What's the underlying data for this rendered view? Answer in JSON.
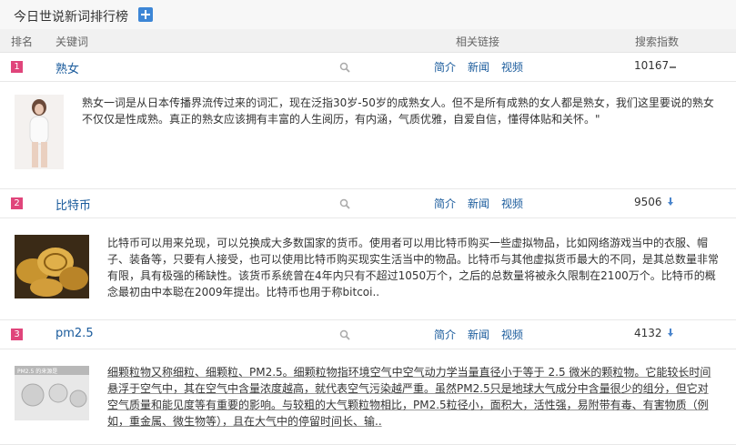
{
  "header": {
    "title": "今日世说新词排行榜",
    "columns": {
      "rank": "排名",
      "keyword": "关键词",
      "links": "相关链接",
      "index": "搜索指数"
    }
  },
  "entries": [
    {
      "rank": "1",
      "keyword": "熟女",
      "links": {
        "intro": "简介",
        "news": "新闻",
        "video": "视频"
      },
      "index": "10167",
      "trend": "flat",
      "description": "熟女一词是从日本传播界流传过来的词汇，现在泛指30岁-50岁的成熟女人。但不是所有成熟的女人都是熟女，我们这里要说的熟女不仅仅是性成熟。真正的熟女应该拥有丰富的人生阅历，有内涵，气质优雅，自爱自信，懂得体贴和关怀。\"",
      "thumb_icon": "photo-woman"
    },
    {
      "rank": "2",
      "keyword": "比特币",
      "links": {
        "intro": "简介",
        "news": "新闻",
        "video": "视频"
      },
      "index": "9506",
      "trend": "down",
      "description": "比特币可以用来兑现，可以兑换成大多数国家的货币。使用者可以用比特币购买一些虚拟物品，比如网络游戏当中的衣服、帽子、装备等，只要有人接受，也可以使用比特币购买现实生活当中的物品。比特币与其他虚拟货币最大的不同，是其总数量非常有限，具有极强的稀缺性。该货币系统曾在4年内只有不超过1050万个，之后的总数量将被永久限制在2100万个。比特币的概念最初由中本聪在2009年提出。比特币也用于称bitcoi..",
      "thumb_icon": "photo-coins"
    },
    {
      "rank": "3",
      "keyword": "pm2.5",
      "links": {
        "intro": "简介",
        "news": "新闻",
        "video": "视频"
      },
      "index": "4132",
      "trend": "down",
      "description": "细颗粒物又称细粒、细颗粒、PM2.5。细颗粒物指环境空气中空气动力学当量直径小于等于 2.5 微米的颗粒物。它能较长时间悬浮于空气中，其在空气中含量浓度越高，就代表空气污染越严重。虽然PM2.5只是地球大气成分中含量很少的组分，但它对空气质量和能见度等有重要的影响。与较粗的大气颗粒物相比，PM2.5粒径小，面积大，活性强，易附带有毒、有害物质（例如，重金属、微生物等），且在大气中的停留时间长、输..",
      "thumb_icon": "photo-pm25",
      "thumb_label": "PM2.5 的来源是"
    }
  ],
  "colors": {
    "accent_link": "#1a5b9c",
    "rank_badge": "#e0457b",
    "trend_down": "#4a85cc",
    "plus_button": "#3d86d6"
  }
}
